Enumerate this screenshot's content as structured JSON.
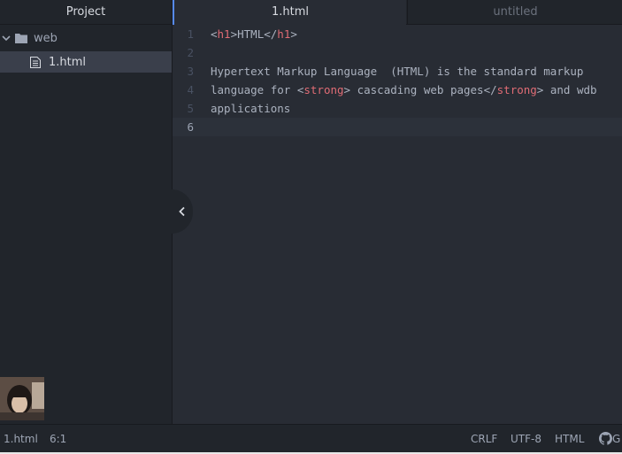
{
  "sidebar": {
    "title": "Project",
    "folder": {
      "label": "web",
      "expanded": true
    },
    "file": {
      "label": "1.html",
      "selected": true
    }
  },
  "tabs": [
    {
      "label": "1.html",
      "active": true
    },
    {
      "label": "untitled",
      "active": false
    }
  ],
  "editor": {
    "lines": [
      {
        "num": "1"
      },
      {
        "num": "2"
      },
      {
        "num": "3",
        "text": "Hypertext Markup Language  (HTML) is the standard markup"
      },
      {
        "num": "4"
      },
      {
        "num": "5",
        "text": "applications"
      },
      {
        "num": "6"
      }
    ],
    "line1": {
      "open_lt": "<",
      "open_tag": "h1",
      "open_gt": ">",
      "content": "HTML",
      "close_lt": "</",
      "close_tag": "h1",
      "close_gt": ">"
    },
    "line4": {
      "pre": "language for ",
      "lt1": "<",
      "tag1": "strong",
      "gt1": ">",
      "mid": " cascading web pages",
      "lt2": "</",
      "tag2": "strong",
      "gt2": ">",
      "post": " and wdb"
    }
  },
  "statusbar": {
    "file": "1.html",
    "cursor": "6:1",
    "line_ending": "CRLF",
    "encoding": "UTF-8",
    "grammar": "HTML",
    "github_label": "G"
  },
  "colors": {
    "background": "#282c34",
    "panel": "#21252b",
    "tag": "#e06c75",
    "text": "#abb2bf",
    "accent": "#568af2"
  },
  "icons": {
    "folder": "folder-icon",
    "file": "file-icon",
    "chevron": "chevron-down-icon",
    "collapse": "chevron-left-icon",
    "github": "github-icon"
  }
}
